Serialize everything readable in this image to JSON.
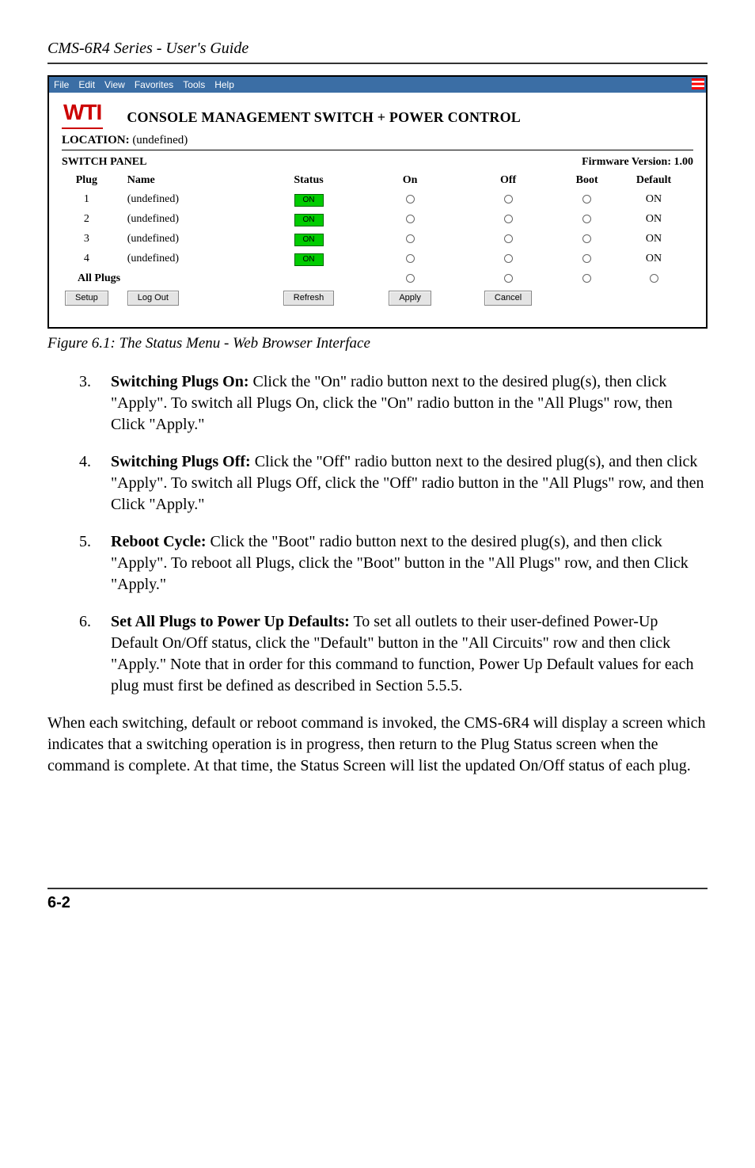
{
  "header": "CMS-6R4 Series - User's Guide",
  "menubar": [
    "File",
    "Edit",
    "View",
    "Favorites",
    "Tools",
    "Help"
  ],
  "app": {
    "brand": "WTI",
    "title": "CONSOLE MANAGEMENT SWITCH + POWER CONTROL",
    "location_label": "LOCATION:",
    "location_value": "(undefined)",
    "panel_label": "SWITCH PANEL",
    "fw_label": "Firmware Version:  1.00",
    "columns": {
      "plug": "Plug",
      "name": "Name",
      "status": "Status",
      "on": "On",
      "off": "Off",
      "boot": "Boot",
      "default": "Default"
    },
    "rows": [
      {
        "plug": "1",
        "name": "(undefined)",
        "status": "ON",
        "default": "ON"
      },
      {
        "plug": "2",
        "name": "(undefined)",
        "status": "ON",
        "default": "ON"
      },
      {
        "plug": "3",
        "name": "(undefined)",
        "status": "ON",
        "default": "ON"
      },
      {
        "plug": "4",
        "name": "(undefined)",
        "status": "ON",
        "default": "ON"
      }
    ],
    "all_plugs": "All Plugs",
    "buttons": {
      "setup": "Setup",
      "logout": "Log Out",
      "refresh": "Refresh",
      "apply": "Apply",
      "cancel": "Cancel"
    }
  },
  "figure_caption": "Figure 6.1:  The Status Menu - Web Browser Interface",
  "items": [
    {
      "num": "3.",
      "bold": "Switching Plugs On:",
      "rest": "  Click the \"On\" radio button next to the desired plug(s), then click \"Apply\".  To switch all Plugs On, click the \"On\" radio button in the \"All Plugs\" row, then Click \"Apply.\""
    },
    {
      "num": "4.",
      "bold": "Switching Plugs Off:",
      "rest": "  Click the \"Off\" radio button next to the desired plug(s), and then click \"Apply\".  To switch all Plugs Off, click the \"Off\" radio button in the \"All Plugs\" row, and then Click \"Apply.\""
    },
    {
      "num": "5.",
      "bold": "Reboot Cycle:",
      "rest": "  Click the \"Boot\" radio button next to the desired plug(s), and then click \"Apply\".  To reboot all Plugs, click the \"Boot\" button in the \"All Plugs\" row, and then Click \"Apply.\""
    },
    {
      "num": "6.",
      "bold": "Set All Plugs to Power Up Defaults:",
      "rest": "  To set all outlets to their user-defined Power-Up Default On/Off status, click the \"Default\" button in the \"All Circuits\" row and then click \"Apply.\"  Note that in order for this command to function, Power Up Default values for each plug must first be defined as described in Section 5.5.5."
    }
  ],
  "paragraph": "When each switching, default or reboot command is invoked, the CMS-6R4 will display a screen which indicates that a switching operation is in progress, then return to the Plug Status screen when the command is complete.  At that time, the Status Screen will list the updated On/Off status of each plug.",
  "footer": "6-2"
}
